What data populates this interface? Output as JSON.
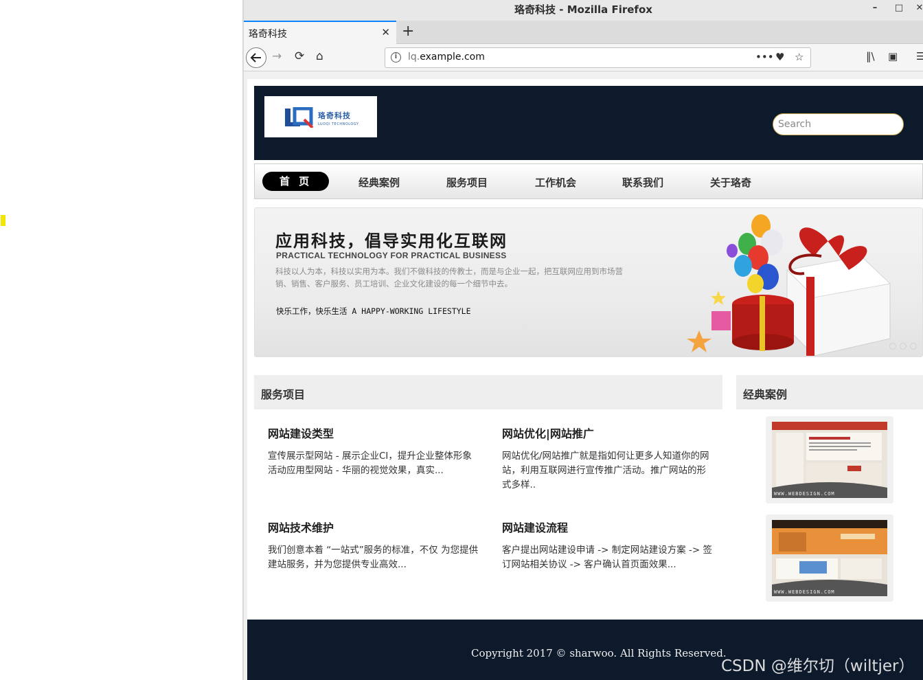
{
  "window": {
    "title": "珞奇科技 - Mozilla Firefox"
  },
  "tab": {
    "label": "珞奇科技"
  },
  "url": {
    "prefix": "lq.",
    "domain": "example.com"
  },
  "site": {
    "logo_cn": "珞奇科技",
    "logo_en": "LUOQI TECHNOLOGY",
    "search_placeholder": "Search",
    "menu": {
      "active": "首 页",
      "items": [
        "经典案例",
        "服务项目",
        "工作机会",
        "联系我们",
        "关于珞奇"
      ]
    },
    "banner": {
      "title": "应用科技，倡导实用化互联网",
      "subtitle": "PRACTICAL TECHNOLOGY FOR PRACTICAL BUSINESS",
      "desc": "科技以人为本，科技以实用为本。我们不做科技的传教士，而是与企业一起，把互联网应用到市场营销、销售、客户服务、员工培训、企业文化建设的每一个细节中去。",
      "slogan": "快乐工作，快乐生活 A HAPPY-WORKING LIFESTYLE"
    },
    "services": {
      "heading": "服务项目",
      "items": [
        {
          "title": "网站建设类型",
          "desc": "宣传展示型网站 - 展示企业CI，提升企业整体形象 活动应用型网站 - 华丽的视觉效果，真实..."
        },
        {
          "title": "网站优化|网站推广",
          "desc": "网站优化/网站推广就是指如何让更多人知道你的网站，利用互联网进行宣传推广活动。推广网站的形式多样.."
        },
        {
          "title": "网站技术维护",
          "desc": "我们创意本着 “一站式”服务的标准，不仅 为您提供建站服务，并为您提供专业高效..."
        },
        {
          "title": "网站建设流程",
          "desc": "客户提出网站建设申请 -> 制定网站建设方案 -> 签订网站相关协议 -> 客户确认首页面效果..."
        }
      ]
    },
    "cases": {
      "heading": "经典案例",
      "captions": [
        "WWW.WEBDESIGN.COM",
        "WWW.WEBDESIGN.COM"
      ]
    },
    "footer": "Copyright 2017 © sharwoo. All Rights Reserved."
  },
  "watermark": "CSDN @维尔切（wiltjer）",
  "colors": {
    "header_bg": "#0d1a2b",
    "search_border": "#c9a84e",
    "tab_accent": "#0a84ff"
  }
}
